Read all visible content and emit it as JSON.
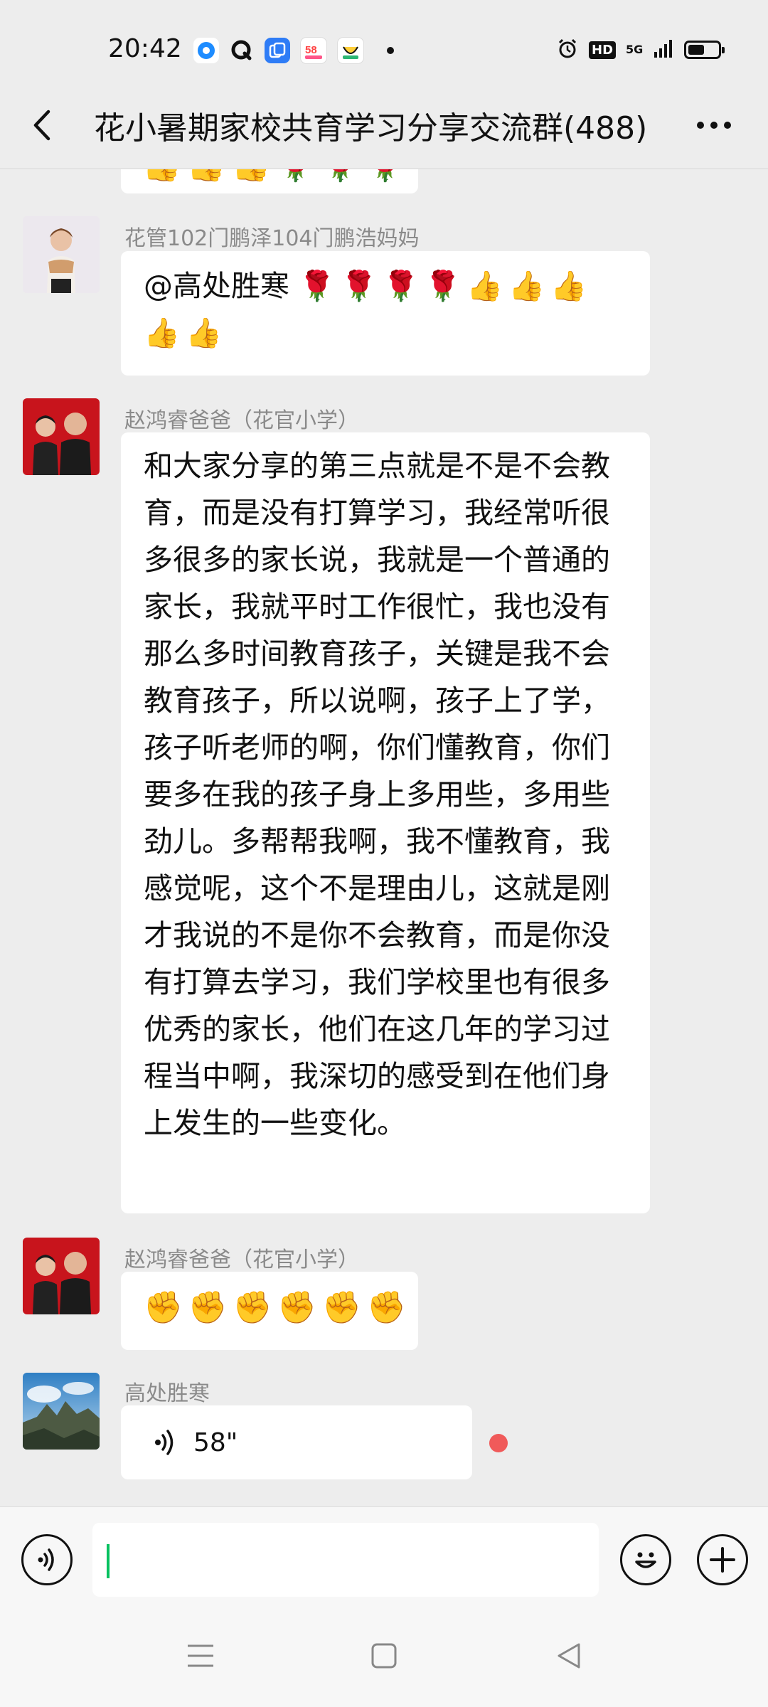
{
  "status_bar": {
    "time": "20:42",
    "battery_level": 0.55,
    "network": "5G"
  },
  "header": {
    "title": "花小暑期家校共育学习分享交流群(488)",
    "back_icon": "chevron-left-icon",
    "more_icon": "more-icon"
  },
  "messages": [
    {
      "sender": "花管102门鹏泽104门鹏浩妈妈",
      "text": "@高处胜寒"
    },
    {
      "sender": "赵鸿睿爸爸（花官小学）",
      "text": "和大家分享的第三点就是不是不会教育，而是没有打算学习，我经常听很多很多的家长说，我就是一个普通的家长，我就平时工作很忙，我也没有那么多时间教育孩子，关键是我不会教育孩子，所以说啊，孩子上了学，孩子听老师的啊，你们懂教育，你们要多在我的孩子身上多用些，多用些劲儿。多帮帮我啊，我不懂教育，我感觉呢，这个不是理由儿，这就是刚才我说的不是你不会教育，而是你没有打算去学习，我们学校里也有很多优秀的家长，他们在这几年的学习过程当中啊，我深切的感受到在他们身上发生的一些变化。"
    },
    {
      "sender": "赵鸿睿爸爸（花官小学）",
      "text": ""
    },
    {
      "sender": "高处胜寒",
      "voice_duration": "58\""
    }
  ],
  "input_bar": {
    "voice_icon": "voice-icon",
    "emoji_icon": "emoji-icon",
    "plus_icon": "plus-icon"
  },
  "colors": {
    "bg": "#ededed",
    "bubble": "#ffffff",
    "accent": "#07c160",
    "unread": "#f05a5a"
  }
}
